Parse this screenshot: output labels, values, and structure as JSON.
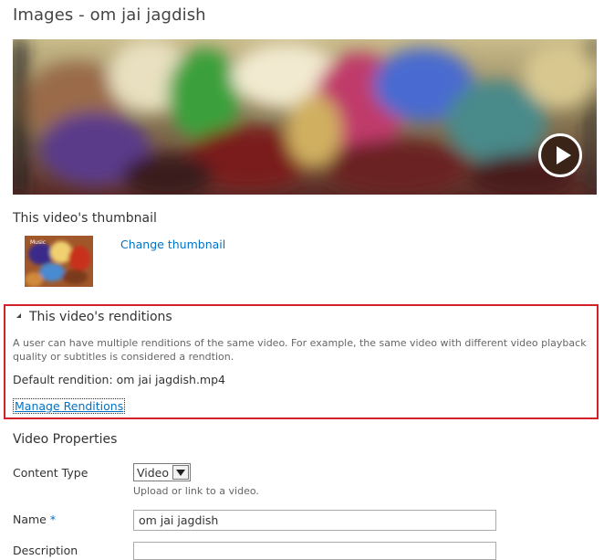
{
  "page": {
    "title": "Images - om jai jagdish"
  },
  "video": {
    "play_icon": "play-icon"
  },
  "thumbnail": {
    "heading": "This video's thumbnail",
    "change_link": "Change thumbnail",
    "thumb_caption": "Music"
  },
  "renditions": {
    "heading": "This video's renditions",
    "expander_icon": "triangle-expanded-icon",
    "description": "A user can have multiple renditions of the same video. For example, the same video with different video playback quality or subtitles is considered a rendtion.",
    "default_label": "Default rendition: om jai jagdish.mp4",
    "manage_link": "Manage Renditions",
    "highlight_color": "#d2232a"
  },
  "properties": {
    "heading": "Video Properties",
    "content_type": {
      "label": "Content Type",
      "value": "Video",
      "hint": "Upload or link to a video."
    },
    "name": {
      "label": "Name",
      "required_mark": "*",
      "value": "om jai jagdish"
    },
    "description": {
      "label": "Description",
      "value": ""
    }
  },
  "colors": {
    "link": "#0072c6",
    "text": "#333333",
    "muted": "#666666"
  }
}
